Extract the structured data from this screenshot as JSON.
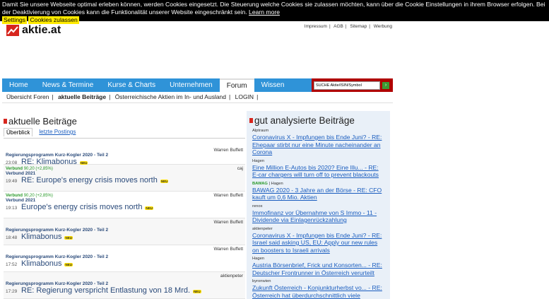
{
  "cookie": {
    "text": "Damit Sie unsere Webseite optimal erleben können, werden Cookies eingesetzt. Die Steuerung welche Cookies sie zulassen möchten, kann über die Cookie Einstellungen in ihrem Browser erfolgen. Bei der Deaktivierung von Cookies kann die Funktionalität unserer Website eingeschränkt sein.",
    "learn_more": "Learn more",
    "settings": "Settings",
    "accept": "Cookies zulassen"
  },
  "logo": {
    "text": "aktie.at"
  },
  "toplinks": [
    "Impressum",
    "AGB",
    "Sitemap",
    "Werbung"
  ],
  "nav": {
    "items": [
      "Home",
      "News & Termine",
      "Kurse & Charts",
      "Unternehmen",
      "Forum",
      "Wissen"
    ],
    "active": "Forum",
    "search_placeholder": "SUCHE Aktie/ISIN/Symbol"
  },
  "subnav": {
    "items": [
      "Übersicht Foren",
      "aktuelle Beiträge",
      "Österreichische Aktien im In- und Ausland",
      "LOGIN"
    ],
    "active": "aktuelle Beiträge"
  },
  "left": {
    "heading": "aktuelle Beiträge",
    "tab_overview": "Überblick",
    "tab_latest": "letzte Postings",
    "neu": "NEU",
    "posts": [
      {
        "author": "Warren Buffett",
        "thread": "Regierungsprogramm Kurz-Kogler 2020 - Teil 2",
        "time": "23:08",
        "title": "RE: Klimabonus"
      },
      {
        "author": "caj",
        "quote_name": "Verbund",
        "quote_val": "90,20 (+2,85%)",
        "thread": "Verbund 2021",
        "time": "19:49",
        "title": "RE: Europe's energy crisis moves north"
      },
      {
        "author": "Warren Buffett",
        "quote_name": "Verbund",
        "quote_val": "90,20 (+2,85%)",
        "thread": "Verbund 2021",
        "time": "19:13",
        "title": "Europe's energy crisis moves north"
      },
      {
        "author": "Warren Buffett",
        "thread": "Regierungsprogramm Kurz-Kogler 2020 - Teil 2",
        "time": "18:48",
        "title": "Klimabonus"
      },
      {
        "author": "Warren Buffett",
        "thread": "Regierungsprogramm Kurz-Kogler 2020 - Teil 2",
        "time": "17:52",
        "title": "Klimabonus"
      },
      {
        "author": "aktienpeter",
        "thread": "Regierungsprogramm Kurz-Kogler 2020 - Teil 2",
        "time": "17:29",
        "title": "RE: Regierung verspricht Entlastung von 18 Mrd."
      }
    ]
  },
  "right": {
    "heading": "gut analysierte Beiträge",
    "items": [
      {
        "author": "Alptraum",
        "link": "Coronavirus X - Impfungen bis Ende Juni? - RE: Ehepaar stirbt nur eine Minute nacheinander an Corona"
      },
      {
        "author": "Hagen",
        "link": "Eine Million E-Autos bis 2020? Eine Illu... - RE: E-car chargers will turn off to prevent blackouts"
      },
      {
        "ticker": "BAWAG",
        "author": "Hagen",
        "link": "BAWAG 2020 - 3 Jahre an der Börse - RE: CFO kauft um 0,6 Mio. Aktien"
      },
      {
        "author": "renox",
        "link": "Immofinanz vor Übernahme von S Immo - 11 - Dividende via Einlagenrückzahlung"
      },
      {
        "author": "aktienpeter",
        "link": "Coronavirus X - Impfungen bis Ende Juni? - RE: Israel said asking US, EU: Apply our new rules on boosters to Israeli arrivals"
      },
      {
        "author": "Hagen",
        "link": "Austria Börsenbrief, Frick und Konsorten... - RE: Deutscher Frontrunner in Österreich verurteilt"
      },
      {
        "author": "byronwien",
        "link": "Zukunft Österreich - Konjunkturherbst vo... - RE: Österreich hat überdurchschnittlich viele"
      }
    ]
  },
  "colors": {
    "nav": "#2f93d8",
    "accent_red": "#d7261e",
    "search_bg": "#b00000",
    "link": "#1a5dbf"
  }
}
